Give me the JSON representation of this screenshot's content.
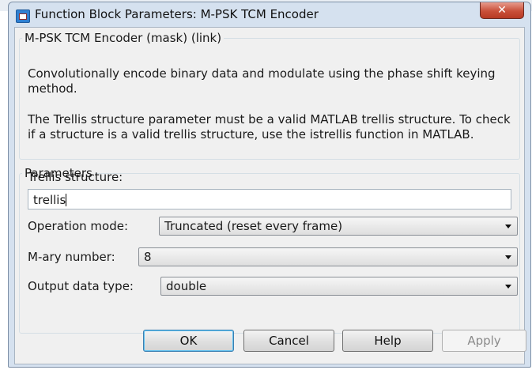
{
  "window": {
    "title": "Function Block Parameters: M-PSK TCM Encoder",
    "close_glyph": "✕"
  },
  "description": {
    "group_label": "M-PSK TCM Encoder (mask) (link)",
    "paragraph1": "Convolutionally encode binary data and modulate using the phase shift keying method.",
    "paragraph2": "The Trellis structure parameter must be a valid MATLAB trellis structure. To check if a structure is a valid trellis structure, use the istrellis function in MATLAB."
  },
  "parameters": {
    "group_label": "Parameters",
    "trellis_label": "Trellis structure:",
    "trellis_value": "trellis",
    "operation_mode_label": "Operation mode:",
    "operation_mode_value": "Truncated (reset every frame)",
    "mary_label": "M-ary number:",
    "mary_value": "8",
    "output_type_label": "Output data type:",
    "output_type_value": "double"
  },
  "buttons": {
    "ok": "OK",
    "cancel": "Cancel",
    "help": "Help",
    "apply": "Apply"
  },
  "colors": {
    "window_frame": "#d5e1ef",
    "client_bg": "#f0f0f0",
    "close_button": "#c9503a",
    "default_button_border": "#3c7fb1"
  },
  "icons": {
    "title": "simulink-block-icon",
    "close": "close-icon",
    "dropdown": "chevron-down-icon"
  }
}
